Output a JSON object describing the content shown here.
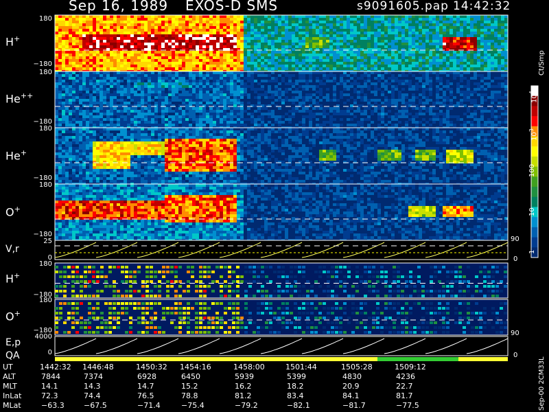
{
  "header": {
    "date": "Sep 16, 1989",
    "mission": "EXOS-D SMS",
    "file": "s9091605.pap",
    "time": "14:42:32"
  },
  "panels": {
    "h_plus": {
      "label": "H",
      "sup": "+",
      "ymax": "180",
      "ymin": "−180"
    },
    "he_pp": {
      "label": "He",
      "sup": "++",
      "ymax": "180",
      "ymin": "−180"
    },
    "he_plus": {
      "label": "He",
      "sup": "+",
      "ymax": "180",
      "ymin": "−180"
    },
    "o_plus": {
      "label": "O",
      "sup": "+",
      "ymax": "180",
      "ymin": "−180"
    },
    "vr": {
      "label": "V,r",
      "ymax": "25",
      "ymin": "0",
      "right_top": "90",
      "right_bottom": "0"
    },
    "h_plus_2": {
      "label": "H",
      "sup": "+",
      "ymax": "180",
      "ymin": "−180"
    },
    "o_plus_2": {
      "label": "O",
      "sup": "+",
      "ymax": "180",
      "ymin": "−180"
    },
    "ep": {
      "label": "E,p",
      "ymax": "4000",
      "ymin": "0",
      "right_top": "90",
      "right_bottom": "0"
    },
    "qa": {
      "label": "QA"
    }
  },
  "colorbar": {
    "unit": "Ct/Smp",
    "ticks": [
      "10",
      "4",
      "10",
      "3",
      "100",
      "10",
      "1"
    ],
    "colors": [
      "#ffffff",
      "#8b0000",
      "#c00000",
      "#ff0000",
      "#ff8c00",
      "#ffd700",
      "#ffff00",
      "#c8e000",
      "#80c000",
      "#40a020",
      "#209040",
      "#008060",
      "#00c8c8",
      "#0090d0",
      "#0060b0",
      "#003c90",
      "#002a70"
    ]
  },
  "footer_code": "Sep-00 2CM33L",
  "table": {
    "row_labels": [
      "UT",
      "ALT",
      "MLT",
      "InLat",
      "MLat"
    ],
    "columns": [
      {
        "UT": "1442:32",
        "ALT": "7844",
        "MLT": "14.1",
        "InLat": "72.3",
        "MLat": "−63.3"
      },
      {
        "UT": "1446:48",
        "ALT": "7374",
        "MLT": "14.3",
        "InLat": "74.4",
        "MLat": "−67.5"
      },
      {
        "UT": "1450:32",
        "ALT": "6928",
        "MLT": "14.7",
        "InLat": "76.5",
        "MLat": "−71.4"
      },
      {
        "UT": "1454:16",
        "ALT": "6450",
        "MLT": "15.2",
        "InLat": "78.8",
        "MLat": "−75.4"
      },
      {
        "UT": "1458:00",
        "ALT": "5939",
        "MLT": "16.2",
        "InLat": "81.2",
        "MLat": "−79.2"
      },
      {
        "UT": "1501:44",
        "ALT": "5399",
        "MLT": "18.2",
        "InLat": "83.4",
        "MLat": "−82.1"
      },
      {
        "UT": "1505:28",
        "ALT": "4830",
        "MLT": "20.9",
        "InLat": "84.1",
        "MLat": "−81.7"
      },
      {
        "UT": "1509:12",
        "ALT": "4236",
        "MLT": "22.7",
        "InLat": "81.7",
        "MLat": "−77.5"
      }
    ]
  },
  "chart_data": {
    "type": "heatmap",
    "title": "Sep 16, 1989   EXOS-D SMS",
    "x": [
      "1442:32",
      "1446:48",
      "1450:32",
      "1454:16",
      "1458:00",
      "1501:44",
      "1505:28",
      "1509:12"
    ],
    "ylim": [
      -180,
      180
    ],
    "series": [
      {
        "name": "H+",
        "bands": [
          {
            "t": [
              0.0,
              0.41
            ],
            "pitch": [
              -180,
              180
            ],
            "level": 0.75
          },
          {
            "t": [
              0.41,
              1.0
            ],
            "pitch": [
              -180,
              180
            ],
            "level": 0.3
          },
          {
            "t": [
              0.06,
              0.4
            ],
            "pitch": [
              -40,
              60
            ],
            "level": 0.95
          },
          {
            "t": [
              0.55,
              0.6
            ],
            "pitch": [
              -20,
              40
            ],
            "level": 0.5
          },
          {
            "t": [
              0.85,
              0.93
            ],
            "pitch": [
              -40,
              50
            ],
            "level": 0.9
          }
        ]
      },
      {
        "name": "He++",
        "bands": [
          {
            "t": [
              0.0,
              0.41
            ],
            "pitch": [
              -180,
              180
            ],
            "level": 0.15
          },
          {
            "t": [
              0.41,
              1.0
            ],
            "pitch": [
              -180,
              180
            ],
            "level": 0.08
          },
          {
            "t": [
              0.17,
              0.3
            ],
            "pitch": [
              80,
              120
            ],
            "level": 0.25
          }
        ]
      },
      {
        "name": "He+",
        "bands": [
          {
            "t": [
              0.0,
              0.41
            ],
            "pitch": [
              -180,
              180
            ],
            "level": 0.15
          },
          {
            "t": [
              0.41,
              1.0
            ],
            "pitch": [
              -180,
              180
            ],
            "level": 0.08
          },
          {
            "t": [
              0.08,
              0.16
            ],
            "pitch": [
              -80,
              100
            ],
            "level": 0.7
          },
          {
            "t": [
              0.16,
              0.24
            ],
            "pitch": [
              20,
              100
            ],
            "level": 0.7
          },
          {
            "t": [
              0.24,
              0.4
            ],
            "pitch": [
              -100,
              110
            ],
            "level": 0.8
          },
          {
            "t": [
              0.58,
              0.62
            ],
            "pitch": [
              -20,
              40
            ],
            "level": 0.5
          },
          {
            "t": [
              0.71,
              0.76
            ],
            "pitch": [
              -30,
              40
            ],
            "level": 0.5
          },
          {
            "t": [
              0.79,
              0.84
            ],
            "pitch": [
              -30,
              40
            ],
            "level": 0.5
          },
          {
            "t": [
              0.86,
              0.92
            ],
            "pitch": [
              -40,
              50
            ],
            "level": 0.6
          }
        ]
      },
      {
        "name": "O+",
        "bands": [
          {
            "t": [
              0.0,
              0.41
            ],
            "pitch": [
              -180,
              180
            ],
            "level": 0.2
          },
          {
            "t": [
              0.41,
              1.0
            ],
            "pitch": [
              -180,
              180
            ],
            "level": 0.08
          },
          {
            "t": [
              0.0,
              0.25
            ],
            "pitch": [
              -40,
              80
            ],
            "level": 0.85
          },
          {
            "t": [
              0.24,
              0.4
            ],
            "pitch": [
              -60,
              120
            ],
            "level": 0.8
          },
          {
            "t": [
              0.78,
              0.84
            ],
            "pitch": [
              -30,
              40
            ],
            "level": 0.6
          },
          {
            "t": [
              0.85,
              0.92
            ],
            "pitch": [
              -30,
              40
            ],
            "level": 0.75
          }
        ]
      }
    ],
    "colorbar_range": [
      1,
      10000
    ],
    "colorbar_unit": "Ct/Smp"
  }
}
